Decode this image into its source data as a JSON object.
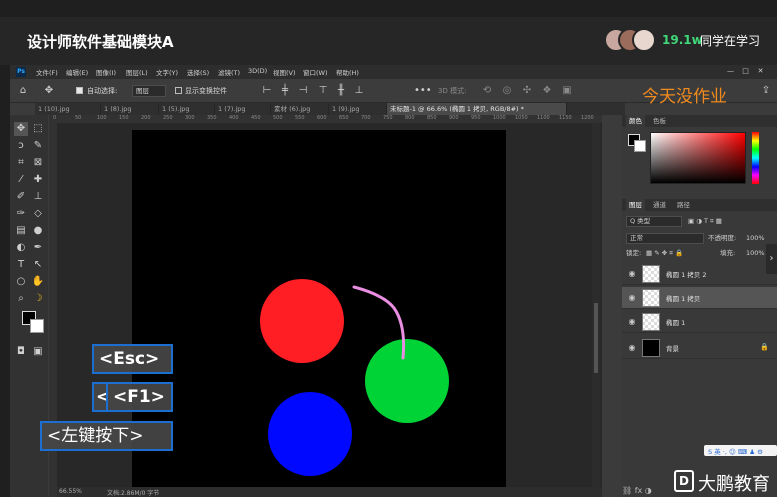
{
  "course": {
    "title": "设计师软件基础模块A",
    "viewer_count": "19.1w",
    "viewer_label": "同学在学习"
  },
  "app": {
    "logo": "Ps",
    "menu": [
      "文件(F)",
      "编辑(E)",
      "图像(I)",
      "图层(L)",
      "文字(Y)",
      "选择(S)",
      "滤镜(T)",
      "3D(D)",
      "视图(V)",
      "窗口(W)",
      "帮助(H)"
    ],
    "window_controls": [
      "—",
      "□",
      "✕"
    ]
  },
  "options_bar": {
    "auto_select_label": "自动选择:",
    "auto_select_target": "图层",
    "show_transform_label": "显示变换控件",
    "mode_3d": "3D 模式:",
    "overlay_text": "今天没作业"
  },
  "doc_tabs": [
    {
      "label": "1 (10).jpg",
      "active": false
    },
    {
      "label": "1 (8).jpg",
      "active": false
    },
    {
      "label": "1 (5).jpg",
      "active": false
    },
    {
      "label": "1 (7).jpg",
      "active": false
    },
    {
      "label": "素材 (6).jpg",
      "active": false
    },
    {
      "label": "1 (9).jpg",
      "active": false
    },
    {
      "label": "未标题-1 @ 66.6% (椭圆 1 拷贝, RGB/8#) *",
      "active": true
    }
  ],
  "ruler": {
    "ticks": [
      "0",
      "50",
      "100",
      "150",
      "200",
      "250",
      "300",
      "350",
      "400",
      "450",
      "500",
      "550",
      "600",
      "650",
      "700",
      "750",
      "800",
      "850",
      "900",
      "950",
      "1000",
      "1050",
      "1100",
      "1150",
      "1200"
    ]
  },
  "canvas": {
    "background": "#000000",
    "circles": [
      {
        "name": "red-circle",
        "color": "#ff1e24"
      },
      {
        "name": "green-circle",
        "color": "#00d336"
      },
      {
        "name": "blue-circle",
        "color": "#0008ff"
      }
    ],
    "stroke_color": "#e98ee0"
  },
  "key_hints": {
    "esc": "<Esc>",
    "f1": "<F1>",
    "left_click": "<左键按下>",
    "partial": "<"
  },
  "panels": {
    "color_tabs": [
      "颜色",
      "色板"
    ],
    "layer_tabs": [
      "图层",
      "通道",
      "路径"
    ],
    "kind_filter": "Q 类型",
    "blend_mode": "正常",
    "opacity_label": "不透明度:",
    "opacity_value": "100%",
    "lock_label": "锁定:",
    "fill_label": "填充:",
    "fill_value": "100%"
  },
  "layers": [
    {
      "name": "椭圆 1 拷贝 2",
      "selected": false,
      "thumb": "checker"
    },
    {
      "name": "椭圆 1 拷贝",
      "selected": true,
      "thumb": "checker"
    },
    {
      "name": "椭圆 1",
      "selected": false,
      "thumb": "checker"
    },
    {
      "name": "背景",
      "selected": false,
      "thumb": "black",
      "locked": true
    }
  ],
  "ime": {
    "text": "S 英 ·, ☺ ⌨ ♟ ⚙"
  },
  "status": {
    "zoom": "66.55%",
    "doc_info": "文档:2.86M/0 字节"
  },
  "branding": {
    "logo_letter": "D",
    "name": "大鹏教育"
  },
  "icons": {
    "home": "home-icon",
    "move": "move-icon",
    "more": "more-icon",
    "gear": "gear-icon"
  }
}
